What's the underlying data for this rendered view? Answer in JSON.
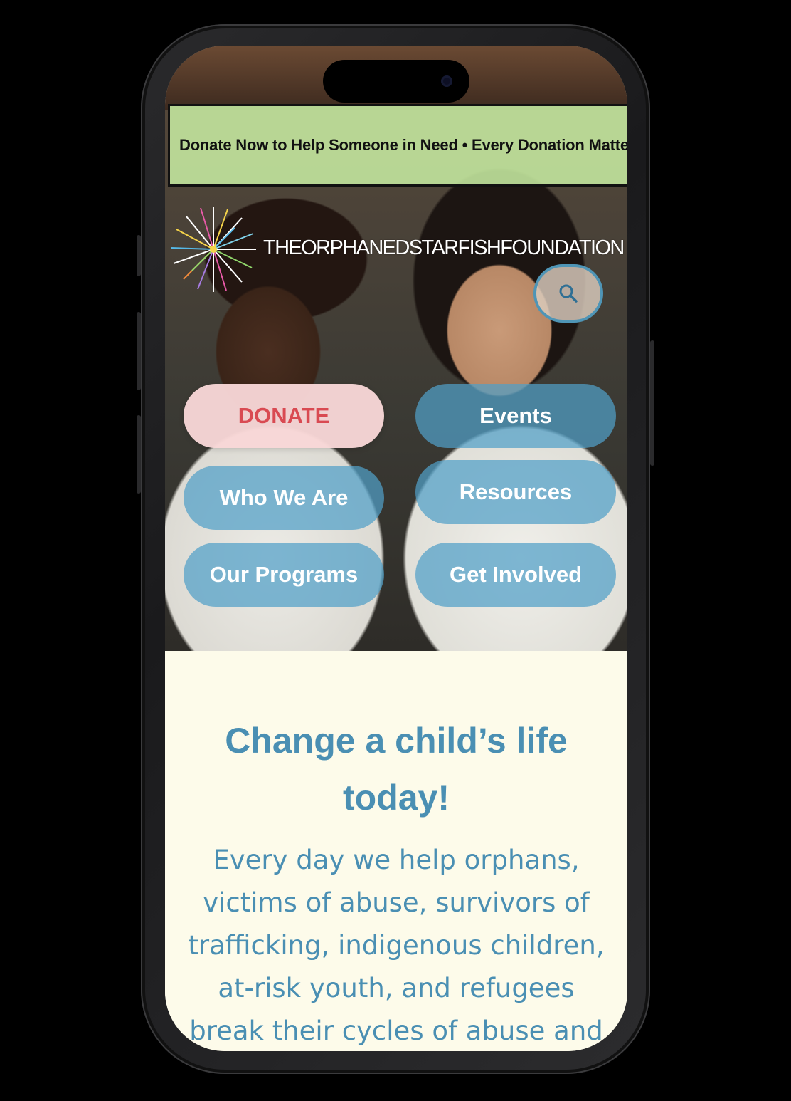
{
  "ticker": {
    "text": "Donate Now to Help Someone in Need • Every Donation Matters"
  },
  "header": {
    "brand": "THEORPHANEDSTARFISHFOUNDATION",
    "search_icon": "search-icon",
    "logo_icon": "starburst-logo"
  },
  "nav": {
    "donate": "DONATE",
    "events": "Events",
    "who_we_are": "Who We Are",
    "resources": "Resources",
    "our_programs": "Our Programs",
    "get_involved": "Get Involved"
  },
  "main": {
    "headline": "Change a child’s life today!",
    "body": "Every day we help orphans, victims of abuse, survivors of trafficking, indigenous children, at-risk youth, and refugees break their cycles of abuse and"
  },
  "colors": {
    "accent": "#4a8fb3",
    "donate_text": "#d94a52",
    "donate_bg": "#f8d6d6",
    "ticker_bg": "#c6eba0",
    "content_bg": "#fdfbea"
  }
}
